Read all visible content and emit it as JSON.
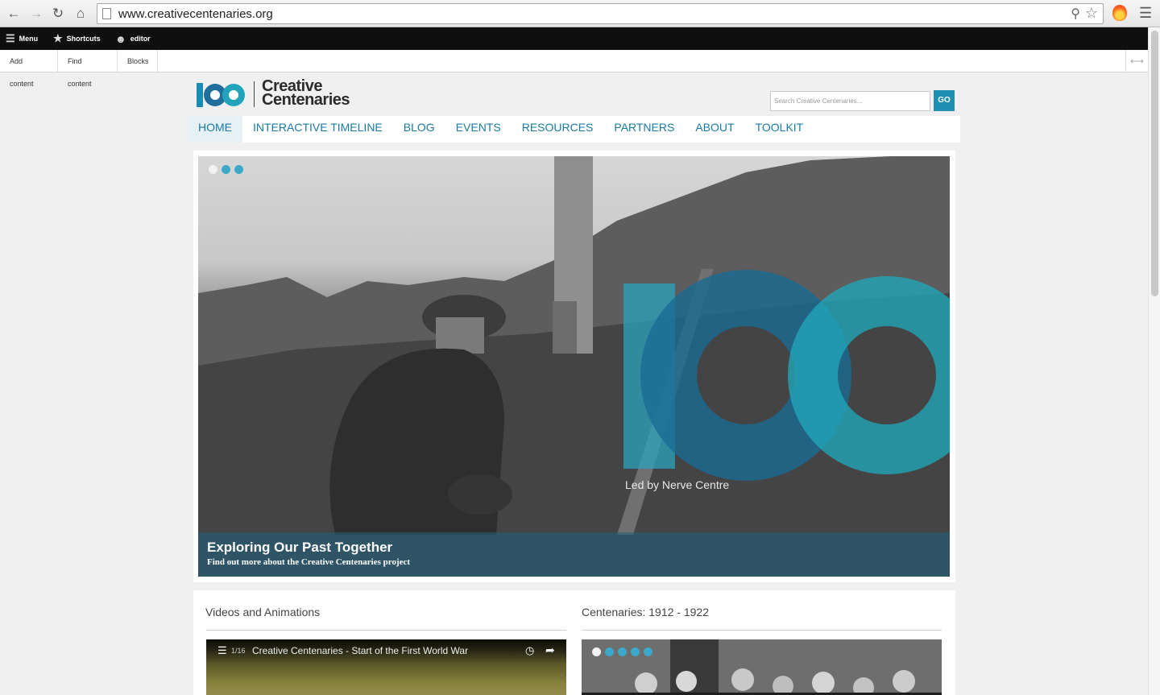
{
  "browser": {
    "url": "www.creativecentenaries.org"
  },
  "toolbar": {
    "menu_label": "Menu",
    "shortcuts_label": "Shortcuts",
    "user_label": "editor",
    "tray": [
      "Add content",
      "Find content",
      "Blocks"
    ]
  },
  "site": {
    "logo_line1": "Creative",
    "logo_line2": "Centenaries",
    "search_placeholder": "Search Creative Centenaries...",
    "search_button": "GO",
    "nav": [
      "HOME",
      "INTERACTIVE TIMELINE",
      "BLOG",
      "EVENTS",
      "RESOURCES",
      "PARTNERS",
      "ABOUT",
      "TOOLKIT"
    ],
    "active_nav": "HOME"
  },
  "hero": {
    "slide_count": 3,
    "active_slide": 1,
    "overlay_text": "Led by Nerve Centre",
    "title": "Exploring Our Past Together",
    "subtitle": "Find out more about the Creative Centenaries project"
  },
  "blocks": {
    "videos": {
      "title": "Videos and Animations",
      "playlist_position": "1/16",
      "video_title": "Creative Centenaries - Start of the First World War"
    },
    "centenaries": {
      "title": "Centenaries: 1912 - 1922",
      "slide_count": 5,
      "active_slide": 1
    }
  },
  "colors": {
    "brand_teal": "#1f8fb4",
    "nav_text": "#1a7aa3",
    "toolbar_bg": "#0f0f0f"
  }
}
